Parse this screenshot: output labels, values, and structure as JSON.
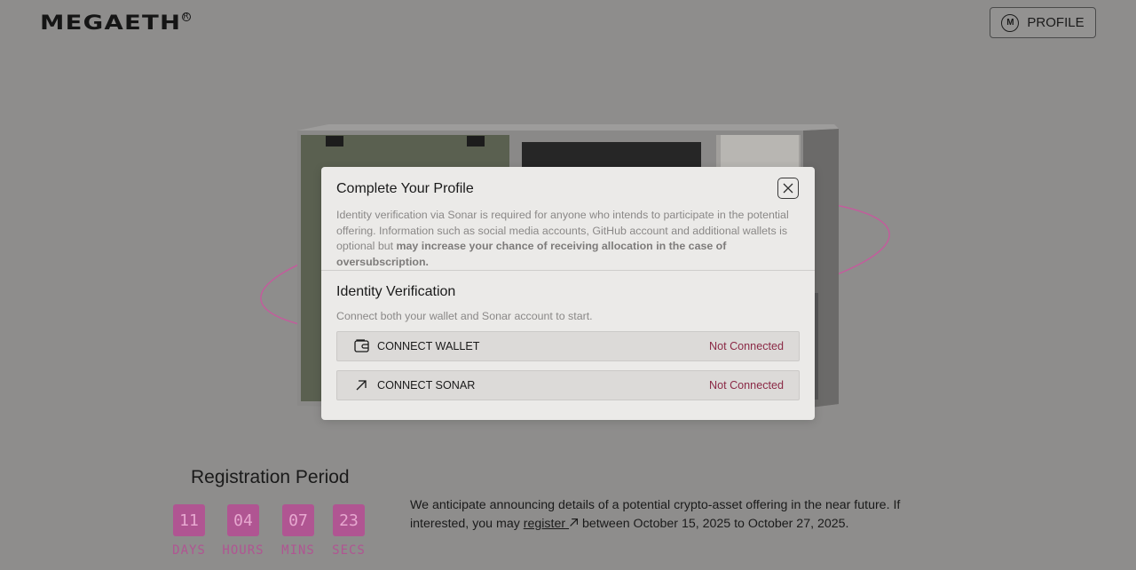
{
  "header": {
    "logo_text": "MEGAETH",
    "logo_mark": "R",
    "profile_label": "PROFILE",
    "profile_icon_letter": "M"
  },
  "modal": {
    "title": "Complete Your Profile",
    "intro_text": "Identity verification via Sonar is required for anyone who intends to participate in the potential offering. Information such as social media accounts, GitHub account and additional wallets is optional but ",
    "intro_bold": "may increase your chance of receiving allocation in the case of oversubscription.",
    "section_title": "Identity Verification",
    "section_subtitle": "Connect both your wallet and Sonar account to start.",
    "rows": [
      {
        "label": "CONNECT WALLET",
        "status": "Not Connected",
        "icon": "wallet-icon"
      },
      {
        "label": "CONNECT SONAR",
        "status": "Not Connected",
        "icon": "arrow-up-right-icon"
      }
    ]
  },
  "registration": {
    "title": "Registration Period",
    "countdown": [
      {
        "value": "11",
        "unit": "DAYS"
      },
      {
        "value": "04",
        "unit": "HOURS"
      },
      {
        "value": "07",
        "unit": "MINS"
      },
      {
        "value": "23",
        "unit": "SECS"
      }
    ]
  },
  "announcement": {
    "text_before": "We anticipate announcing details of a potential crypto-asset offering in the near future. If interested, you may ",
    "link_text": "register",
    "text_after": " between October 15, 2025 to October 27, 2025."
  },
  "colors": {
    "accent": "#b05592",
    "status": "#8b2a46",
    "background": "#8e8d8c"
  }
}
